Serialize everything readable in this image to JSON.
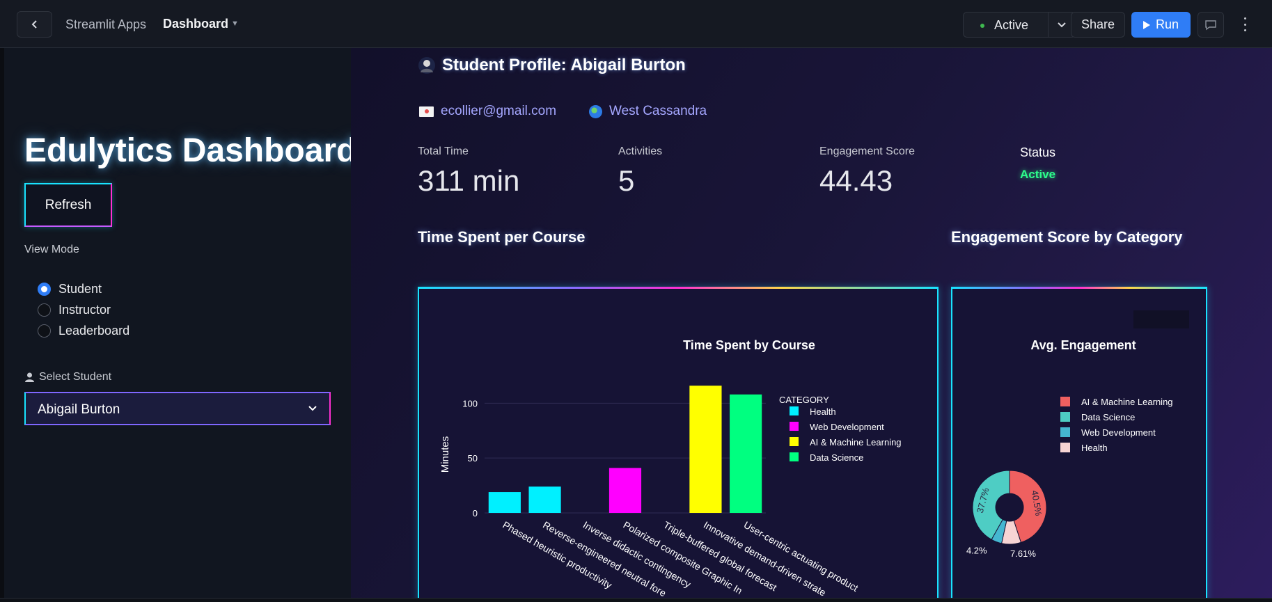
{
  "topbar": {
    "app_name": "Streamlit Apps",
    "page_name": "Dashboard",
    "status": "Active",
    "share_label": "Share",
    "run_label": "Run"
  },
  "sidebar": {
    "title": "Edulytics Dashboard",
    "refresh_label": "Refresh",
    "view_mode_label": "View Mode",
    "view_modes": [
      "Student",
      "Instructor",
      "Leaderboard"
    ],
    "view_mode_selected": "Student",
    "select_student_label": "Select Student",
    "selected_student": "Abigail Burton"
  },
  "profile": {
    "title": "Student Profile: Abigail Burton",
    "email": "ecollier@gmail.com",
    "location": "West Cassandra"
  },
  "metrics": [
    {
      "label": "Total Time",
      "value": "311 min"
    },
    {
      "label": "Activities",
      "value": "5"
    },
    {
      "label": "Engagement Score",
      "value": "44.43"
    }
  ],
  "status": {
    "label": "Status",
    "value": "Active"
  },
  "sections": {
    "time_title": "Time Spent per Course",
    "engagement_title": "Engagement Score by Category"
  },
  "colors": {
    "health": "#00f0ff",
    "web_development": "#ff00ff",
    "ai_ml": "#ffff00",
    "data_science": "#00ff80",
    "pie_ai_ml": "#ef6060",
    "pie_data_science": "#4ecdc4",
    "pie_web_development": "#45b7d1",
    "pie_health": "#f7d4d4",
    "accent_blue": "#2f7df6",
    "neon_cyan": "#19e3ff",
    "neon_magenta": "#ff2fd2"
  },
  "chart_data": [
    {
      "type": "bar",
      "title": "Time Spent by Course",
      "xlabel": "",
      "ylabel": "Minutes",
      "ylim": [
        0,
        118
      ],
      "yticks": [
        0,
        50,
        100
      ],
      "legend_title": "CATEGORY",
      "legend_position": "top-right",
      "categories": [
        "Phased heuristic productivity",
        "Reverse-engineered neutral fore",
        "Inverse didactic contingency",
        "Polarized composite Graphic In",
        "Triple-buffered global forecast",
        "Innovative demand-driven strate",
        "User-centric actuating product"
      ],
      "series": [
        {
          "name": "Health",
          "values": [
            19,
            24,
            null,
            null,
            null,
            null,
            null
          ]
        },
        {
          "name": "Web Development",
          "values": [
            null,
            null,
            null,
            41,
            null,
            null,
            null
          ]
        },
        {
          "name": "AI & Machine Learning",
          "values": [
            null,
            null,
            null,
            null,
            null,
            116,
            null
          ]
        },
        {
          "name": "Data Science",
          "values": [
            null,
            null,
            null,
            null,
            null,
            null,
            108
          ]
        }
      ]
    },
    {
      "type": "pie",
      "title": "Avg. Engagement",
      "legend_position": "top-right",
      "labels": [
        "AI & Machine Learning",
        "Data Science",
        "Web Development",
        "Health"
      ],
      "values": [
        40.5,
        37.7,
        4.2,
        7.61
      ],
      "value_labels": [
        "40.5%",
        "37.7%",
        "4.2%",
        "7.61%"
      ]
    }
  ]
}
